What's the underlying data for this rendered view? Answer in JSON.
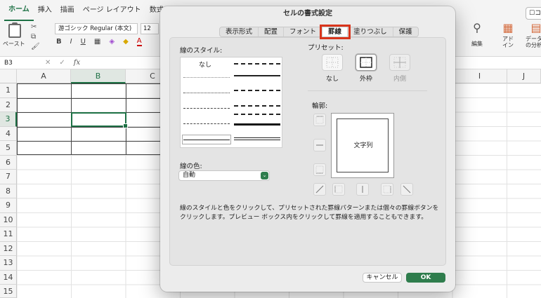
{
  "ribbon": {
    "tabs": [
      "ホーム",
      "挿入",
      "描画",
      "ページ レイアウト",
      "数式"
    ],
    "active_tab": "ホーム",
    "paste_label": "ペースト",
    "font_name": "游ゴシック Regular (本文)",
    "font_size": "12",
    "bold": "B",
    "italic": "I",
    "underline": "U",
    "font_color_letter": "A",
    "edit_label": "編集",
    "addin_label": "アド\nイン",
    "analyze_label": "データ\nの分析",
    "comment_label": "コ"
  },
  "formula_bar": {
    "name_box": "B3",
    "fx_label": "fx",
    "cancel_glyph": "✕",
    "enter_glyph": "✓"
  },
  "grid": {
    "columns": [
      "A",
      "B",
      "C",
      "",
      "",
      "",
      "",
      "",
      "I",
      "J"
    ],
    "rows": [
      "1",
      "2",
      "3",
      "4",
      "5",
      "6",
      "7",
      "8",
      "9",
      "10",
      "11",
      "12",
      "13",
      "14",
      "15"
    ],
    "selected_column": "B",
    "selected_row": "3"
  },
  "dialog": {
    "title": "セルの書式設定",
    "tabs": [
      "表示形式",
      "配置",
      "フォント",
      "罫線",
      "塗りつぶし",
      "保護"
    ],
    "active_tab": "罫線",
    "line_style_label": "線のスタイル:",
    "none_label": "なし",
    "line_color_label": "線の色:",
    "line_color_value": "自動",
    "preset_label": "プリセット:",
    "presets": [
      {
        "label": "なし",
        "enabled": true
      },
      {
        "label": "外枠",
        "enabled": true
      },
      {
        "label": "内側",
        "enabled": false
      }
    ],
    "border_label": "輪郭:",
    "preview_text": "文字列",
    "description": "線のスタイルと色をクリックして、プリセットされた罫線パターンまたは個々の罫線ボタンをクリックします。プレビュー ボックス内をクリックして罫線を適用することもできます。",
    "cancel_label": "キャンセル",
    "ok_label": "OK"
  }
}
